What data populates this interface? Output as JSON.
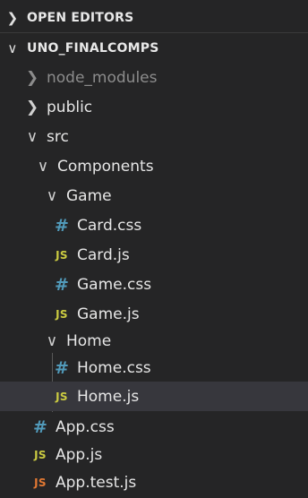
{
  "sections": {
    "open_editors": "OPEN EDITORS",
    "project": "UNO_FINALCOMPS"
  },
  "chevrons": {
    "collapsed": "›",
    "expanded": "⌄"
  },
  "icons": {
    "css_glyph": "#",
    "js_glyph": "JS",
    "css_color": "#519aba",
    "js_color": "#cbcb41",
    "test_js_color": "#e37933"
  },
  "tree": {
    "node_modules": "node_modules",
    "public": "public",
    "src": "src",
    "components": "Components",
    "game": "Game",
    "card_css": "Card.css",
    "card_js": "Card.js",
    "game_css": "Game.css",
    "game_js": "Game.js",
    "home": "Home",
    "home_css": "Home.css",
    "home_js": "Home.js",
    "app_css": "App.css",
    "app_js": "App.js",
    "app_test_js": "App.test.js"
  },
  "selected_file": "Home.js"
}
